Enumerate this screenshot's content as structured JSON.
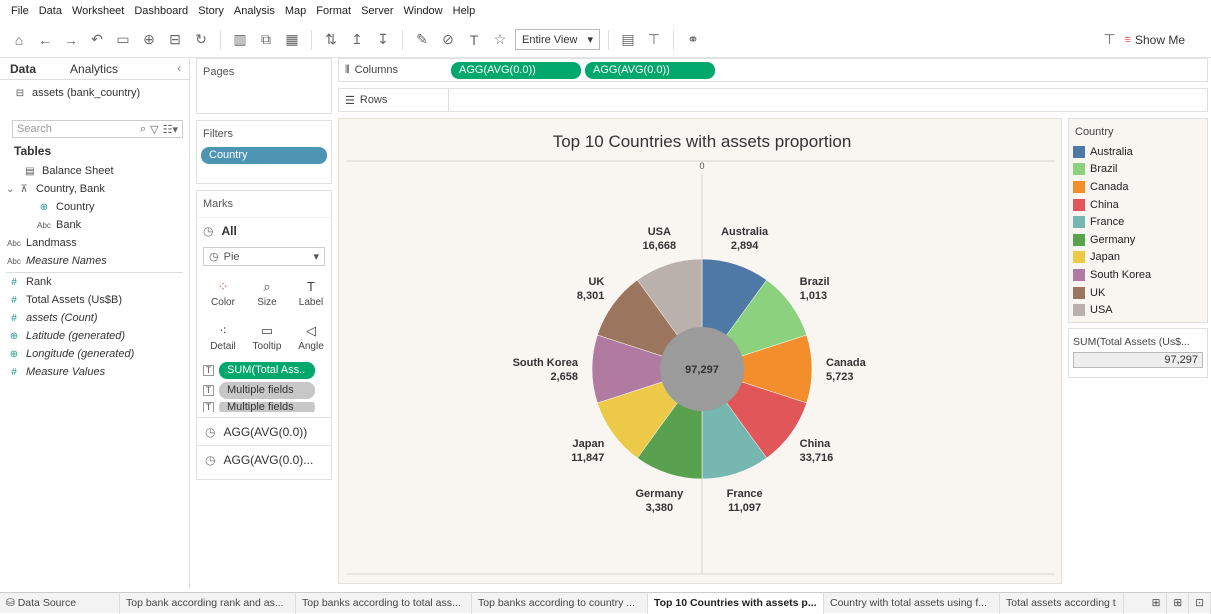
{
  "menu": [
    "File",
    "Data",
    "Worksheet",
    "Dashboard",
    "Story",
    "Analysis",
    "Map",
    "Format",
    "Server",
    "Window",
    "Help"
  ],
  "toolbar": {
    "view_mode": "Entire View",
    "show_me": "Show Me"
  },
  "left": {
    "tab_data": "Data",
    "tab_analytics": "Analytics",
    "datasource": "assets (bank_country)",
    "search_placeholder": "Search",
    "tables_header": "Tables",
    "fields": [
      {
        "icon": "table-icon",
        "label": "Balance Sheet",
        "italic": false
      },
      {
        "icon": "hierarchy-icon",
        "label": "Country, Bank",
        "italic": false
      },
      {
        "icon": "globe-icon",
        "label": "Country",
        "italic": false
      },
      {
        "icon": "abc-icon",
        "label": "Bank",
        "italic": false
      },
      {
        "icon": "abc-icon",
        "label": "Landmass",
        "italic": false
      },
      {
        "icon": "abc-icon",
        "label": "Measure Names",
        "italic": true
      },
      {
        "icon": "hash-icon",
        "label": "Rank",
        "italic": false
      },
      {
        "icon": "hash-icon",
        "label": "Total Assets (Us$B)",
        "italic": false
      },
      {
        "icon": "hash-icon",
        "label": "assets (Count)",
        "italic": true
      },
      {
        "icon": "globe-icon",
        "label": "Latitude (generated)",
        "italic": true
      },
      {
        "icon": "globe-icon",
        "label": "Longitude (generated)",
        "italic": true
      },
      {
        "icon": "hash-icon",
        "label": "Measure Values",
        "italic": true
      }
    ]
  },
  "pages_label": "Pages",
  "filters_label": "Filters",
  "filter_pill": "Country",
  "marks": {
    "label": "Marks",
    "all": "All",
    "type": "Pie",
    "buttons": [
      "Color",
      "Size",
      "Label",
      "Detail",
      "Tooltip",
      "Angle"
    ],
    "pills": [
      "SUM(Total Ass..",
      "Multiple fields",
      "Multiple fields"
    ],
    "sections": [
      "AGG(AVG(0.0))",
      "AGG(AVG(0.0)..."
    ]
  },
  "shelves": {
    "columns_label": "Columns",
    "rows_label": "Rows",
    "columns_pills": [
      "AGG(AVG(0.0))",
      "AGG(AVG(0.0))"
    ]
  },
  "chart_data": {
    "type": "pie",
    "title": "Top 10 Countries with assets proportion",
    "axis_zero_label": "0",
    "center_label": "97,297",
    "categories": [
      "Australia",
      "Brazil",
      "Canada",
      "China",
      "France",
      "Germany",
      "Japan",
      "South Korea",
      "UK",
      "USA"
    ],
    "values": [
      2894,
      1013,
      5723,
      33716,
      11097,
      3380,
      11847,
      2658,
      8301,
      16668
    ],
    "value_labels": [
      "2,894",
      "1,013",
      "5,723",
      "33,716",
      "11,097",
      "3,380",
      "11,847",
      "2,658",
      "8,301",
      "16,668"
    ],
    "colors": [
      "#4e79a7",
      "#8cd17d",
      "#f28e2b",
      "#e15759",
      "#76b7b2",
      "#59a14f",
      "#edc948",
      "#b07aa1",
      "#9c755f",
      "#bab0ac"
    ]
  },
  "legend": {
    "title": "Country",
    "size_title": "SUM(Total Assets (Us$...",
    "size_value": "97,297"
  },
  "tabs": {
    "data_source": "Data Source",
    "sheets": [
      "Top bank according rank and as...",
      "Top banks according to total ass...",
      "Top banks according to country ...",
      "Top 10 Countries with assets p...",
      "Country with total assets using f...",
      "Total assets according t"
    ],
    "active_index": 3
  }
}
